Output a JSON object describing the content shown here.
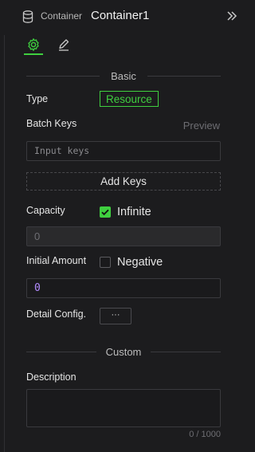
{
  "header": {
    "kind_label": "Container",
    "name": "Container1"
  },
  "tabs": [
    {
      "icon": "gear-icon",
      "active": true
    },
    {
      "icon": "pencil-icon",
      "active": false
    }
  ],
  "sections": {
    "basic": "Basic",
    "custom": "Custom"
  },
  "fields": {
    "type_label": "Type",
    "type_value": "Resource",
    "batch_keys_label": "Batch Keys",
    "preview_label": "Preview",
    "input_keys_placeholder": "Input keys",
    "add_keys_label": "Add Keys",
    "capacity_label": "Capacity",
    "infinite_label": "Infinite",
    "infinite_checked": true,
    "capacity_value": "0",
    "initial_amount_label": "Initial Amount",
    "negative_label": "Negative",
    "negative_checked": false,
    "initial_amount_value": "0",
    "detail_config_label": "Detail Config.",
    "detail_config_button": "···",
    "description_label": "Description",
    "description_value": "",
    "description_counter": "0 / 1000"
  },
  "colors": {
    "accent": "#3fcf3f",
    "background": "#1c1c1e",
    "number_value": "#b38cff"
  }
}
